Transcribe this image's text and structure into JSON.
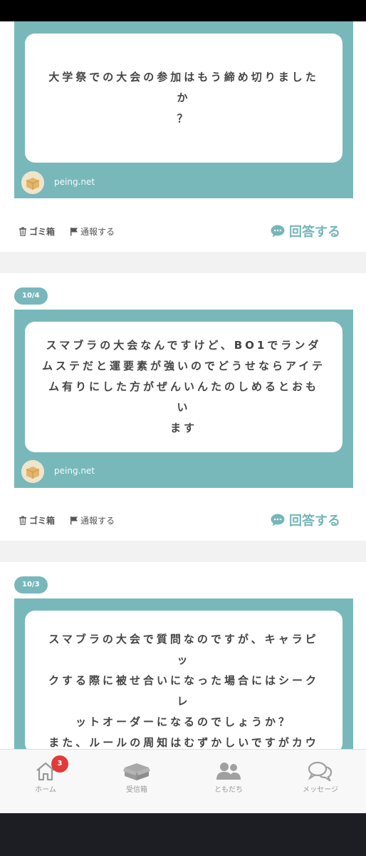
{
  "site": "peing.net",
  "actions": {
    "trash_label": "ゴミ箱",
    "report_label": "通報する",
    "answer_label": "回答する"
  },
  "questions": [
    {
      "date": "",
      "text": "大学祭での大会の参加はもう締め切りましたか\n？",
      "site": "peing.net"
    },
    {
      "date": "10/4",
      "text": "スマブラの大会なんですけど、BO1でランダ\nムステだと運要素が強いのでどうせならアイテ\nム有りにした方がぜんいんたのしめるとおもい\nます",
      "site": "peing.net"
    },
    {
      "date": "10/3",
      "text": "スマブラの大会で質問なのですが、キャラピッ\nクする際に被せ合いになった場合にはシークレ\nットオーダーになるのでしょうか？\nまた、ルールの周知はむずかしいですがカウン\nターステージ制を採用した方が公平な気がしま\nす！",
      "site": ""
    }
  ],
  "nav": {
    "home_label": "ホーム",
    "home_badge": "3",
    "inbox_label": "受信箱",
    "friends_label": "ともだち",
    "messages_label": "メッセージ"
  },
  "colors": {
    "accent": "#78b8bb",
    "badge": "#e03a3a"
  }
}
